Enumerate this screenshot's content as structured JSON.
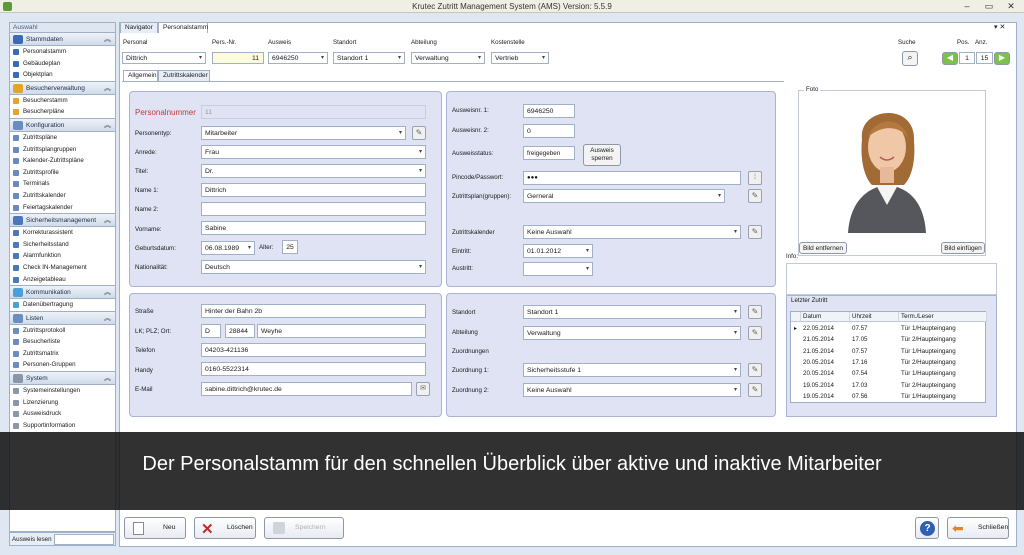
{
  "window": {
    "title": "Krutec Zutritt Management System (AMS)  Version: 5.5.9",
    "minimize": "–",
    "restore": "▭",
    "close": "✕"
  },
  "sidebar": {
    "header": "Auswahl",
    "groups": [
      {
        "label": "Stammdaten",
        "color": "#3a6bb5",
        "items": [
          "Personalstamm",
          "Gebäudeplan",
          "Objektplan"
        ]
      },
      {
        "label": "Besucherverwaltung",
        "color": "#e2a52a",
        "items": [
          "Besucherstamm",
          "Besucherpläne"
        ]
      },
      {
        "label": "Konfiguration",
        "color": "#6a8bc2",
        "items": [
          "Zutrittspläne",
          "Zutrittsplangruppen",
          "Kalender-Zutrittspläne",
          "Zutrittsprofile",
          "Terminals",
          "Zutrittskalender",
          "Feiertagskalender"
        ]
      },
      {
        "label": "Sicherheitsmanagement",
        "color": "#4a78b8",
        "items": [
          "Korrekturassistent",
          "Sicherheitsstand",
          "Alarmfunktion",
          "Check IN-Management",
          "Anzeigetableau"
        ]
      },
      {
        "label": "Kommunikation",
        "color": "#4aa0d8",
        "items": [
          "Datenübertragung"
        ]
      },
      {
        "label": "Listen",
        "color": "#6d8cc0",
        "items": [
          "Zutrittsprotokoll",
          "Besucherliste",
          "Zutrittsmatrix",
          "Personen-Gruppen"
        ]
      },
      {
        "label": "System",
        "color": "#8a96aa",
        "items": [
          "Systemeinstellungen",
          "Lizenzierung",
          "Ausweisdruck",
          "Supportinformation"
        ]
      }
    ],
    "footer_label": "Ausweis lesen"
  },
  "tabs": {
    "navigator": "Navigator",
    "personalstamm": "Personalstamm"
  },
  "header": {
    "personal_label": "Personal",
    "personal_value": "Dittrich",
    "persnr_label": "Pers.-Nr.",
    "persnr_value": "11",
    "ausweis_label": "Ausweis",
    "ausweis_value": "6946250",
    "standort_label": "Standort",
    "standort_value": "Standort 1",
    "abteilung_label": "Abteilung",
    "abteilung_value": "Verwaltung",
    "kostenstelle_label": "Kostenstelle",
    "kostenstelle_value": "Vertrieb",
    "suche_label": "Suche",
    "pos_label": "Pos.",
    "pos_value": "1",
    "anz_label": "Anz.",
    "anz_value": "15"
  },
  "subtabs": {
    "allgemein": "Allgemein",
    "zutrittskalender": "Zutrittskalender"
  },
  "person": {
    "personalnummer_label": "Personalnummer",
    "personalnummer_value": "11",
    "personentyp_label": "Personentyp:",
    "personentyp_value": "Mitarbeiter",
    "anrede_label": "Anrede:",
    "anrede_value": "Frau",
    "titel_label": "Titel:",
    "titel_value": "Dr.",
    "name1_label": "Name 1:",
    "name1_value": "Dittrich",
    "name2_label": "Name 2:",
    "name2_value": "",
    "vorname_label": "Vorname:",
    "vorname_value": "Sabine",
    "geburtsdatum_label": "Geburtsdatum:",
    "geburtsdatum_value": "06.08.1989",
    "alter_label": "Alter:",
    "alter_value": "25",
    "nationalitaet_label": "Nationalität:",
    "nationalitaet_value": "Deutsch"
  },
  "ausweis": {
    "nr1_label": "Ausweisnr. 1:",
    "nr1_value": "6946250",
    "nr2_label": "Ausweisnr. 2:",
    "nr2_value": "0",
    "status_label": "Ausweisstatus:",
    "status_value": "freigegeben",
    "sperren_button": "Ausweis sperren",
    "pincode_label": "Pincode/Passwort:",
    "pincode_value": "●●●",
    "plan_label": "Zutrittsplan(gruppen):",
    "plan_value": "Gerneral",
    "kalender_label": "Zutrittskalender",
    "kalender_value": "Keine Auswahl",
    "eintritt_label": "Eintritt:",
    "eintritt_value": "01.01.2012",
    "austritt_label": "Austritt:",
    "austritt_value": ""
  },
  "address": {
    "strasse_label": "Straße",
    "strasse_value": "Hinter der Bahn 2b",
    "lkplz_label": "LK; PLZ; Ort:",
    "lk_value": "D",
    "plz_value": "28844",
    "ort_value": "Weyhe",
    "telefon_label": "Telefon",
    "telefon_value": "04203-421136",
    "handy_label": "Handy",
    "handy_value": "0160-5522314",
    "email_label": "E-Mail",
    "email_value": "sabine.dittrich@krutec.de"
  },
  "assignment": {
    "standort_label": "Standort",
    "standort_value": "Standort 1",
    "abteilung_label": "Abteilung",
    "abteilung_value": "Verwaltung",
    "zuordnungen_label": "Zuordnungen",
    "zuordnung1_label": "Zuordnung 1:",
    "zuordnung1_value": "Sicherheitsstufe 1",
    "zuordnung2_label": "Zuordnung 2:",
    "zuordnung2_value": "Keine Auswahl"
  },
  "photo": {
    "label": "Foto",
    "remove_button": "Bild entfernen",
    "insert_button": "Bild einfügen",
    "info_label": "Info:"
  },
  "letzter_zutritt": {
    "title": "Letzter Zutritt",
    "columns": [
      "Datum",
      "Uhrzeit",
      "Term./Leser"
    ],
    "rows": [
      [
        "22.05.2014",
        "07.57",
        "Tür 1/Haupteingang"
      ],
      [
        "21.05.2014",
        "17.05",
        "Tür 2/Haupteingang"
      ],
      [
        "21.05.2014",
        "07.57",
        "Tür 1/Haupteingang"
      ],
      [
        "20.05.2014",
        "17.16",
        "Tür 2/Haupteingang"
      ],
      [
        "20.05.2014",
        "07.54",
        "Tür 1/Haupteingang"
      ],
      [
        "19.05.2014",
        "17.03",
        "Tür 2/Haupteingang"
      ],
      [
        "19.05.2014",
        "07.56",
        "Tür 1/Haupteingang"
      ]
    ]
  },
  "buttons": {
    "neu": "Neu",
    "loeschen": "Löschen",
    "speichern": "Speichern",
    "schliessen": "Schließen"
  },
  "caption": "Der Personalstamm für den schnellen Überblick über aktive und inaktive Mitarbeiter",
  "colors": {
    "accent": "#c33c3c",
    "panel": "#dfe3f3",
    "caption_bg": "#141414"
  }
}
